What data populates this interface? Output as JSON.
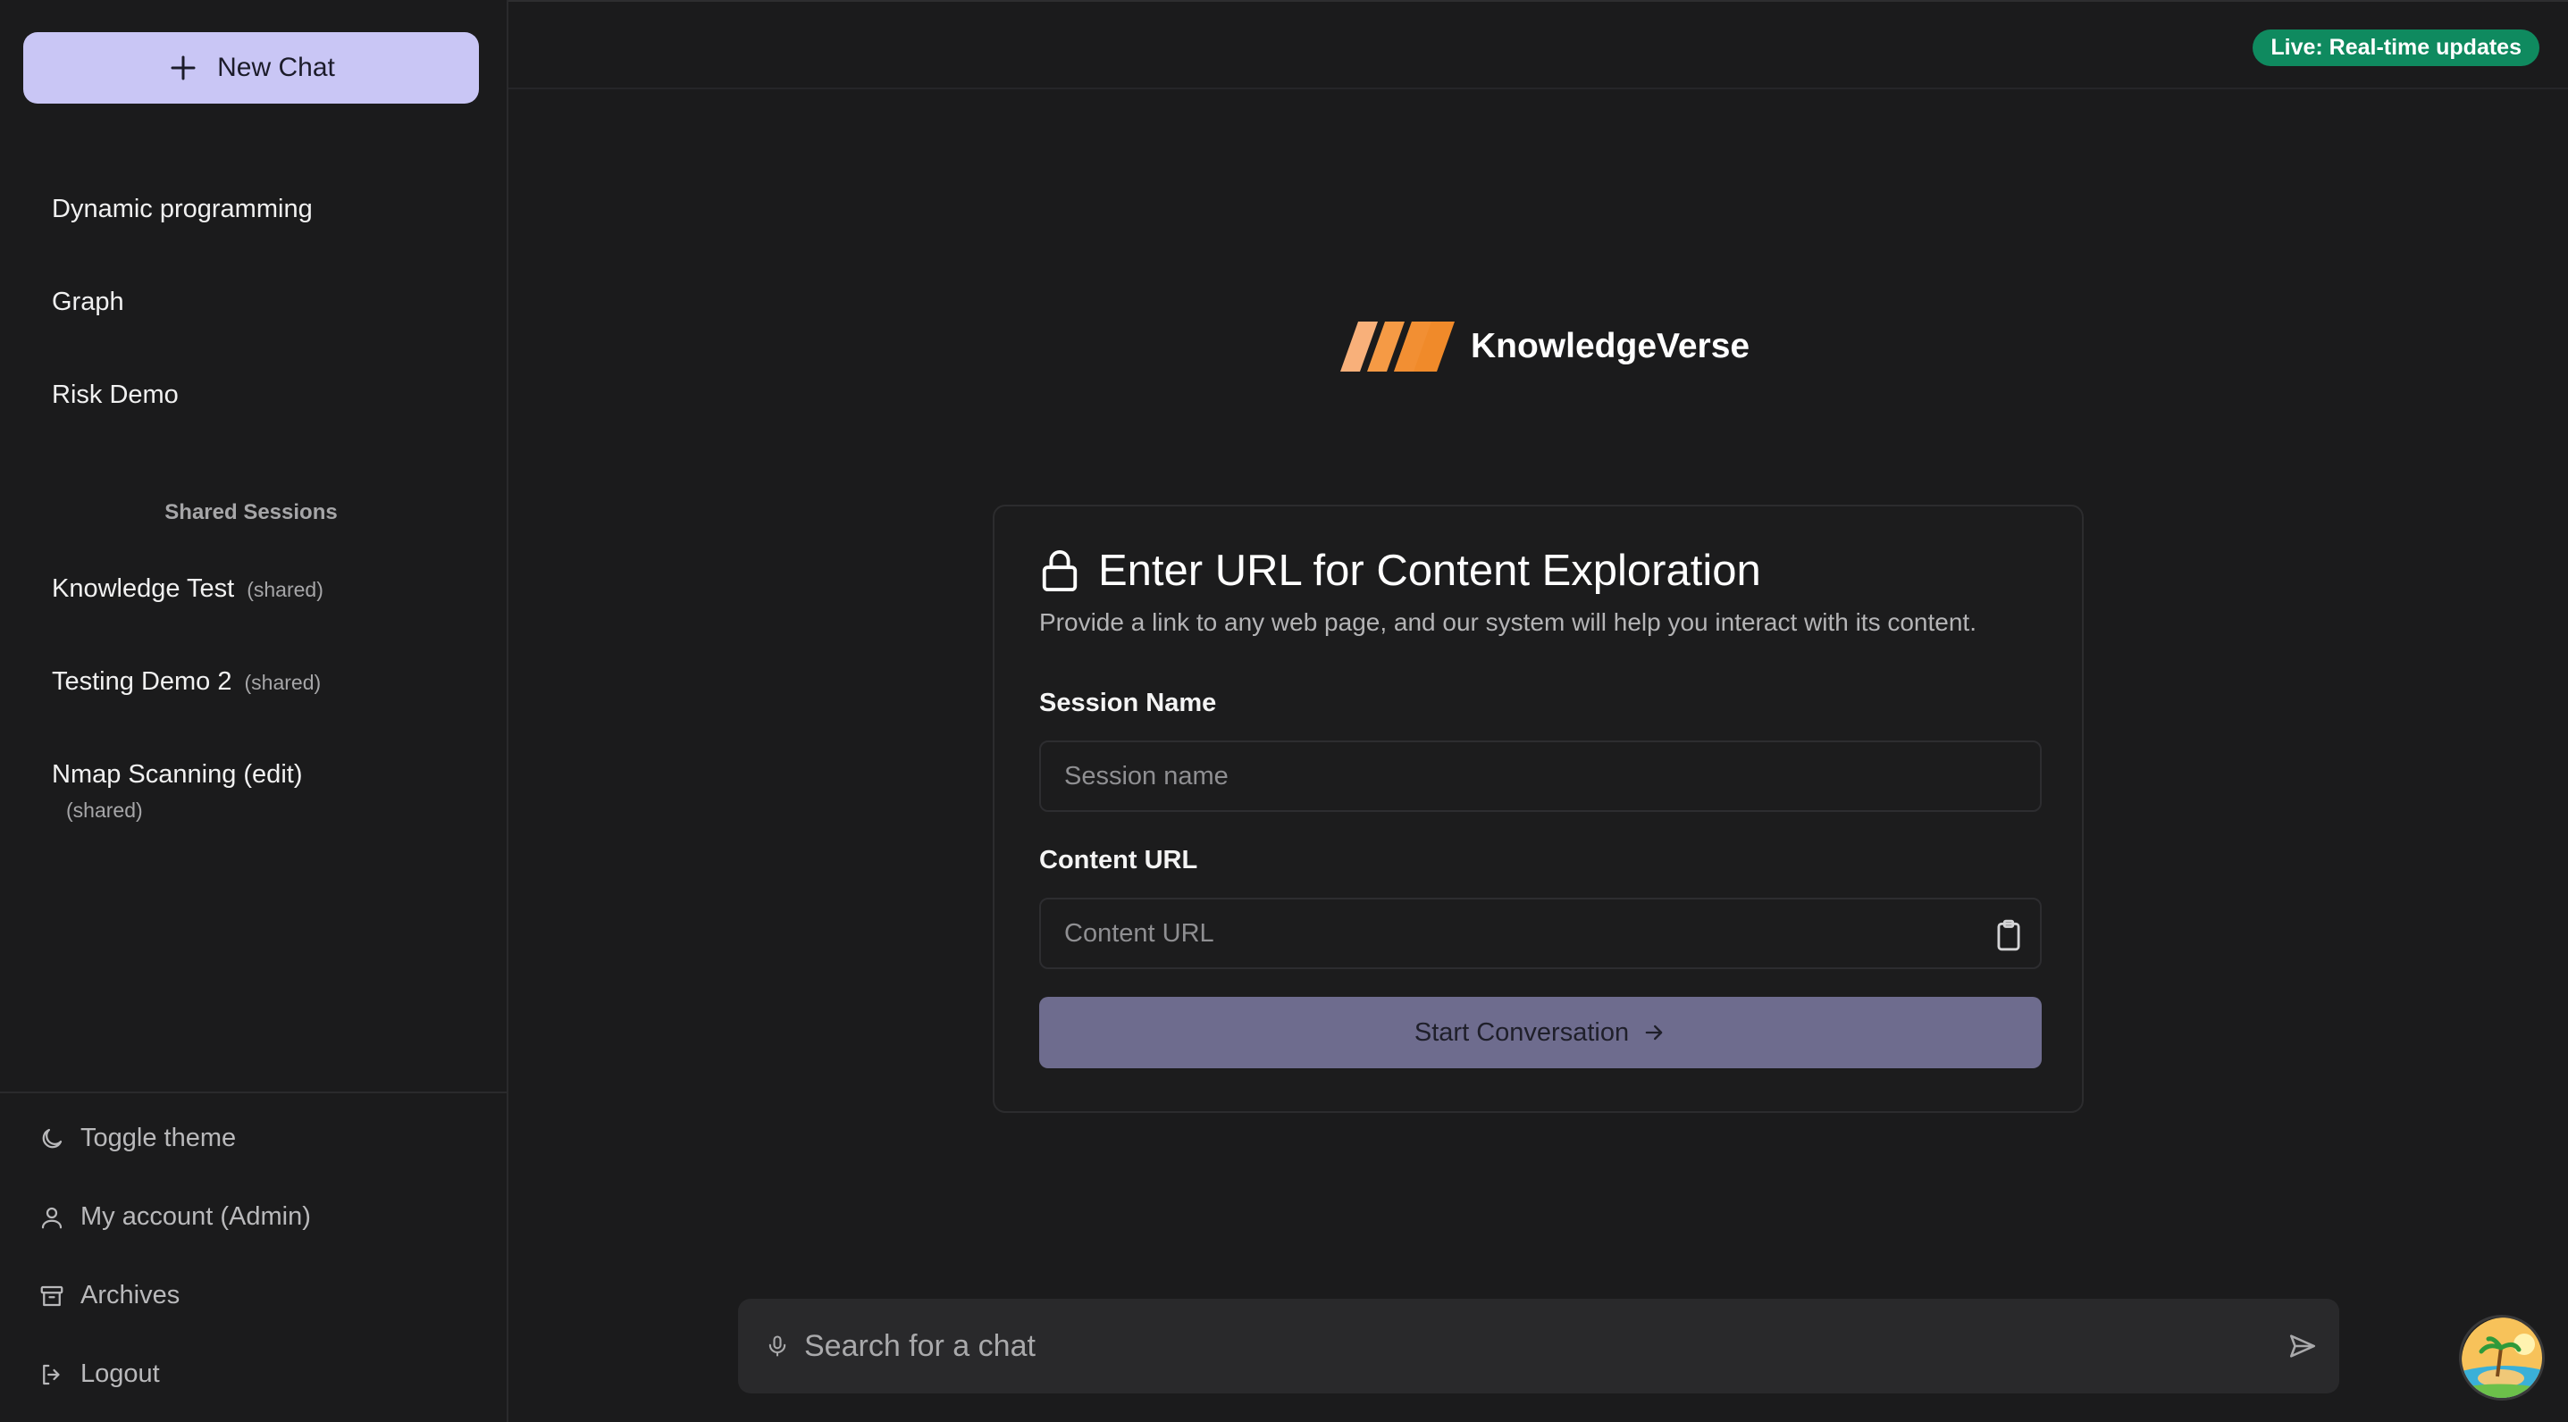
{
  "sidebar": {
    "new_chat_label": "New Chat",
    "chats": [
      {
        "label": "Dynamic programming"
      },
      {
        "label": "Graph"
      },
      {
        "label": "Risk Demo"
      }
    ],
    "shared_header": "Shared Sessions",
    "shared": [
      {
        "label": "Knowledge Test",
        "tag": "(shared)"
      },
      {
        "label": "Testing Demo 2",
        "tag": "(shared)"
      },
      {
        "label": "Nmap Scanning (edit)",
        "tag": "(shared)"
      }
    ],
    "bottom": {
      "toggle_theme": "Toggle theme",
      "my_account": "My account (Admin)",
      "archives": "Archives",
      "logout": "Logout"
    }
  },
  "topbar": {
    "live_badge": "Live: Real-time updates"
  },
  "brand": {
    "name": "KnowledgeVerse"
  },
  "card": {
    "title": "Enter URL for Content Exploration",
    "subtitle": "Provide a link to any web page, and our system will help you interact with its content.",
    "session_label": "Session Name",
    "session_placeholder": "Session name",
    "session_value": "",
    "url_label": "Content URL",
    "url_placeholder": "Content URL",
    "url_value": "",
    "start_label": "Start Conversation"
  },
  "search": {
    "placeholder": "Search for a chat"
  },
  "colors": {
    "background": "#1b1b1c",
    "new_chat_bg": "#c9c6f5",
    "start_btn_bg": "#6e6c8e",
    "live_badge_bg": "#0f8a5f",
    "logo_orange": "#f08a2a"
  },
  "icons": [
    "plus-icon",
    "lock-icon",
    "clipboard-icon",
    "arrow-right-icon",
    "mic-icon",
    "send-icon",
    "moon-icon",
    "user-icon",
    "archive-icon",
    "logout-icon"
  ]
}
